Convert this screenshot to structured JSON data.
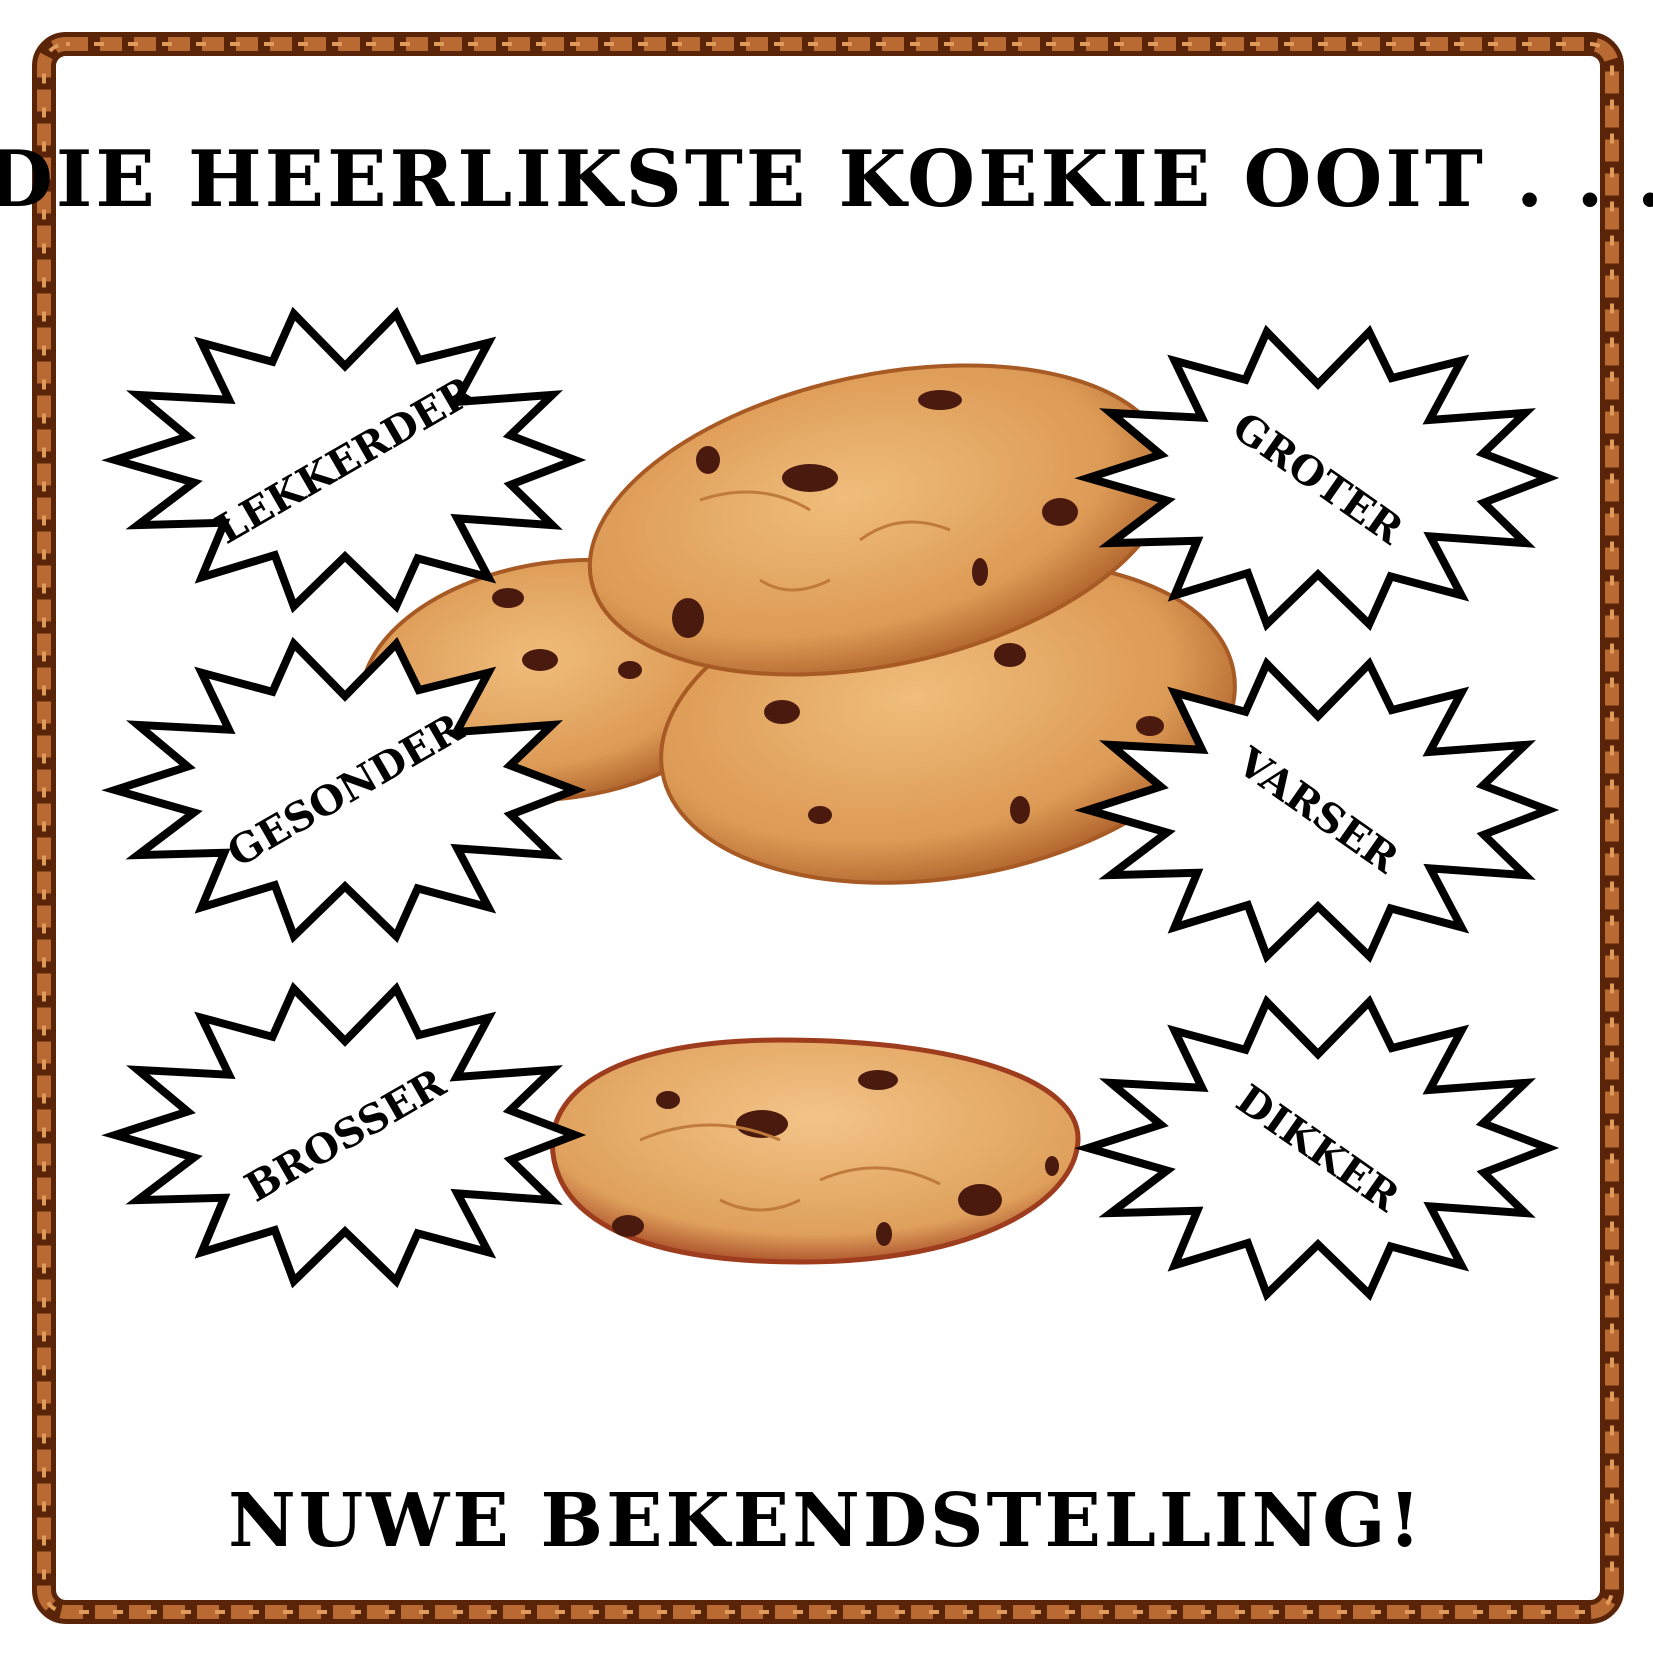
{
  "poster": {
    "title": "DIE HEERLIKSTE KOEKIE OOIT . . .",
    "footer": "NUWE BEKENDSTELLING!",
    "claims": [
      "LEKKERDER",
      "GROTER",
      "GESONDER",
      "VARSER",
      "BROSSER",
      "DIKKER"
    ]
  },
  "colors": {
    "frame": "#8a3f14",
    "frame_light": "#c8743a",
    "cookie": "#e3a460",
    "cookie_edge": "#b0662a",
    "chip": "#4a1a0e",
    "ink": "#000000"
  },
  "icons": [
    "starburst-icon",
    "cookie-icon",
    "twisted-rope-frame"
  ]
}
